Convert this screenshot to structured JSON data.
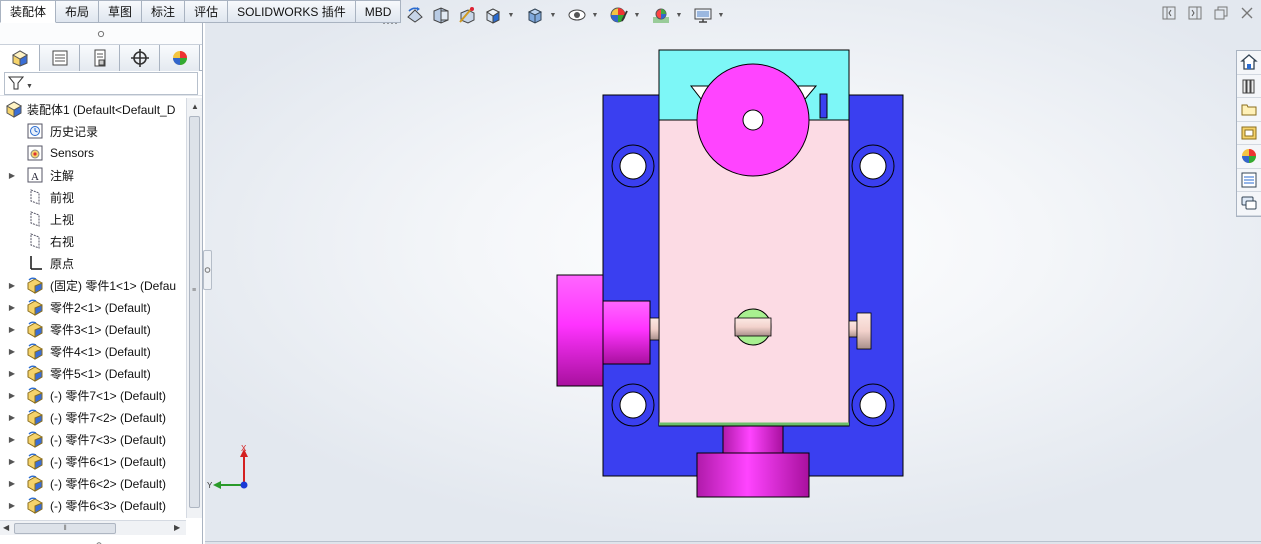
{
  "tabs": [
    "装配体",
    "布局",
    "草图",
    "标注",
    "评估",
    "SOLIDWORKS 插件",
    "MBD"
  ],
  "active_tab": "装配体",
  "hud_icons": [
    "zoom-to-fit-icon",
    "zoom-to-area-icon",
    "previous-view-icon",
    "section-view-icon",
    "dynamic-annotation-icon",
    "view-orientation-icon",
    "display-style-icon",
    "hide-show-items-icon",
    "edit-appearance-icon",
    "apply-scene-icon",
    "view-settings-icon"
  ],
  "window_icons": [
    "tile-left-icon",
    "tile-right-icon",
    "restore-icon",
    "close-icon"
  ],
  "task_pane_icons": [
    "home-icon",
    "design-library-icon",
    "file-explorer-icon",
    "view-palette-icon",
    "appearances-icon",
    "custom-properties-icon",
    "forum-icon"
  ],
  "panel_tabs": [
    "featuremanager-icon",
    "propertymanager-icon",
    "configurationmanager-icon",
    "dimxpert-icon",
    "displaymanager-icon"
  ],
  "tree": [
    {
      "label": "装配体1  (Default<Default_D",
      "type": "assembly",
      "expand": false,
      "indent": 0
    },
    {
      "label": "历史记录",
      "type": "history",
      "expand": false,
      "indent": 1
    },
    {
      "label": "Sensors",
      "type": "sensors",
      "expand": false,
      "indent": 1
    },
    {
      "label": "注解",
      "type": "annotation",
      "expand": true,
      "indent": 1
    },
    {
      "label": "前视",
      "type": "plane",
      "expand": false,
      "indent": 1
    },
    {
      "label": "上视",
      "type": "plane",
      "expand": false,
      "indent": 1
    },
    {
      "label": "右视",
      "type": "plane",
      "expand": false,
      "indent": 1
    },
    {
      "label": "原点",
      "type": "origin",
      "expand": false,
      "indent": 1
    },
    {
      "label": "(固定) 零件1<1> (Defau",
      "type": "part",
      "expand": true,
      "indent": 1
    },
    {
      "label": "零件2<1> (Default)",
      "type": "part",
      "expand": true,
      "indent": 1
    },
    {
      "label": "零件3<1> (Default)",
      "type": "part",
      "expand": true,
      "indent": 1
    },
    {
      "label": "零件4<1> (Default)",
      "type": "part",
      "expand": true,
      "indent": 1
    },
    {
      "label": "零件5<1> (Default)",
      "type": "part",
      "expand": true,
      "indent": 1
    },
    {
      "label": "(-) 零件7<1> (Default)",
      "type": "part",
      "expand": true,
      "indent": 1
    },
    {
      "label": "(-) 零件7<2> (Default)",
      "type": "part",
      "expand": true,
      "indent": 1
    },
    {
      "label": "(-) 零件7<3> (Default)",
      "type": "part",
      "expand": true,
      "indent": 1
    },
    {
      "label": "(-) 零件6<1> (Default)",
      "type": "part",
      "expand": true,
      "indent": 1
    },
    {
      "label": "(-) 零件6<2> (Default)",
      "type": "part",
      "expand": true,
      "indent": 1
    },
    {
      "label": "(-) 零件6<3> (Default)",
      "type": "part",
      "expand": true,
      "indent": 1
    }
  ],
  "triad": {
    "x_label": "X",
    "y_label": "Y"
  },
  "colors": {
    "base_plate": "#3a3ff0",
    "body": "#fcdbe4",
    "top_block": "#7df7f7",
    "magenta": "#ff44ff",
    "pin_green": "#a8f090",
    "tab_border": "#a9b3c1"
  }
}
